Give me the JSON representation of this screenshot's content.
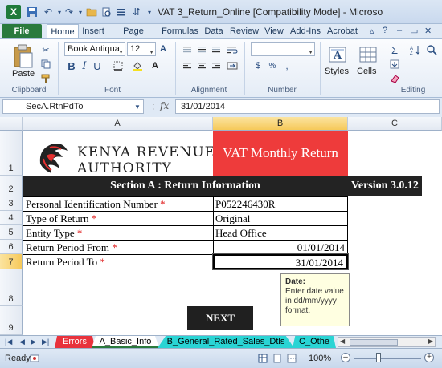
{
  "window": {
    "title": "VAT 3_Return_Online  [Compatibility Mode] - Microso"
  },
  "ribbon_tabs": [
    "File",
    "Home",
    "Insert",
    "Page Layout",
    "Formulas",
    "Data",
    "Review",
    "View",
    "Add-Ins",
    "Acrobat"
  ],
  "ribbon": {
    "paste_label": "Paste",
    "clipboard_label": "Clipboard",
    "font_name": "Book Antiqua",
    "font_size": "12",
    "font_label": "Font",
    "alignment_label": "Alignment",
    "number_label": "Number",
    "styles_label": "Styles",
    "cells_label": "Cells",
    "editing_label": "Editing"
  },
  "formula_bar": {
    "name_box": "SecA.RtnPdTo",
    "fx": "fx",
    "value": "31/01/2014"
  },
  "columns": [
    "A",
    "B",
    "C"
  ],
  "rows": [
    "1",
    "2",
    "3",
    "4",
    "5",
    "6",
    "7",
    "8",
    "9"
  ],
  "sheet": {
    "logo_line1": "KENYA REVENUE",
    "logo_line2": "AUTHORITY",
    "header_title": "VAT Monthly Return",
    "section_title": "Section A : Return Information",
    "version": "Version 3.0.12",
    "fields": [
      {
        "label": "Personal Identification Number",
        "value": "P052246430R"
      },
      {
        "label": "Type of Return",
        "value": "Original"
      },
      {
        "label": "Entity Type",
        "value": "Head Office"
      },
      {
        "label": "Return Period From",
        "value": "01/01/2014"
      },
      {
        "label": "Return Period To",
        "value": "31/01/2014"
      }
    ],
    "required_mark": "*",
    "tooltip_title": "Date:",
    "tooltip_body": "Enter date value in dd/mm/yyyy format.",
    "next_button": "NEXT"
  },
  "sheet_tabs": [
    {
      "label": "Errors",
      "color": "#e8323c"
    },
    {
      "label": "A_Basic_Info",
      "color": "#ffffff"
    },
    {
      "label": "B_General_Rated_Sales_Dtls",
      "color": "#2ad4d4"
    },
    {
      "label": "C_Othe",
      "color": "#2ad4d4"
    }
  ],
  "status": {
    "ready": "Ready",
    "zoom": "100%"
  },
  "colors": {
    "header_red": "#ee3b3b",
    "section_black": "#232323",
    "active_header": "#f6c95a"
  }
}
